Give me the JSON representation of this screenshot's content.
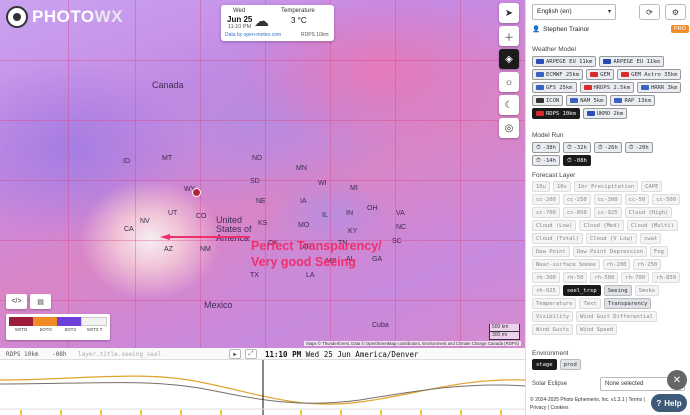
{
  "logo": {
    "text_a": "PHOTO",
    "text_b": "WX"
  },
  "weather": {
    "day": "Wed",
    "date": "Jun 25",
    "time": "11:10 PM",
    "temp_label": "Temperature",
    "temp_value": "3 °C",
    "source": "Data by open-meteo.com",
    "model": "RDPS 10km"
  },
  "map": {
    "labels": [
      "Canada",
      "MT",
      "ND",
      "MN",
      "ID",
      "SD",
      "WI",
      "MI",
      "WY",
      "NE",
      "IA",
      "IL",
      "IN",
      "OH",
      "NV",
      "UT",
      "CO",
      "KS",
      "MO",
      "KY",
      "CA",
      "AZ",
      "NM",
      "OK",
      "AR",
      "TN",
      "TX",
      "LA",
      "MS",
      "AL",
      "GA",
      "SC",
      "NC",
      "VA",
      "United States of America",
      "Mexico",
      "Cuba"
    ],
    "annotation_line1": "Perfect Transparency/",
    "annotation_line2": "Very good Seeing",
    "attribution": "Maps © Thunderforest, Data © OpenStreetMap contributors, Environment and Climate Change Canada (RDPS)",
    "scale_km": "500 km",
    "scale_mi": "300 mi"
  },
  "legend": {
    "labels": [
      "5OTO",
      "5OTO",
      "5OT3",
      "5OT3 T"
    ],
    "colors": [
      "#9b1d3a",
      "#f08a24",
      "#6c3fd8",
      "#f2f2f2"
    ]
  },
  "timeline": {
    "model": "RDPS 10km",
    "offset": "-08h",
    "layer": "layer.title.seeing_seal",
    "current_time": "11:10 PM",
    "current_date": "Wed 25 Jun America/Denver"
  },
  "panel": {
    "language": "English (en)",
    "user": "Stephen Trainor",
    "pro_badge": "PRO",
    "weather_model_title": "Weather Model",
    "models": [
      {
        "label": "ARPEGE EU 11km",
        "flag": "#2a4fbd",
        "sel": false
      },
      {
        "label": "ARPEGE EU 11km",
        "flag": "#234ba8",
        "sel": false
      },
      {
        "label": "ECMWF 25km",
        "flag": "#3a62c2",
        "sel": false
      },
      {
        "label": "GEM",
        "flag": "#d92b2b",
        "sel": false
      },
      {
        "label": "GEM Astro 35km",
        "flag": "#d92b2b",
        "sel": false
      },
      {
        "label": "GFS 25km",
        "flag": "#3a62c2",
        "sel": false
      },
      {
        "label": "HRDPS 2.5km",
        "flag": "#d92b2b",
        "sel": false
      },
      {
        "label": "HRRR 3km",
        "flag": "#3a62c2",
        "sel": false
      },
      {
        "label": "ICON",
        "flag": "#333333",
        "sel": false
      },
      {
        "label": "NAM 5km",
        "flag": "#3a62c2",
        "sel": false
      },
      {
        "label": "RAP 13km",
        "flag": "#3a62c2",
        "sel": false
      },
      {
        "label": "RDPS 10km",
        "flag": "#d92b2b",
        "sel": true
      },
      {
        "label": "UKMO 2km",
        "flag": "#2a4fbd",
        "sel": false
      }
    ],
    "model_run_title": "Model Run",
    "runs": [
      {
        "label": "-38h",
        "sel": false
      },
      {
        "label": "-32h",
        "sel": false
      },
      {
        "label": "-26h",
        "sel": false
      },
      {
        "label": "-20h",
        "sel": false
      },
      {
        "label": "-14h",
        "sel": false
      },
      {
        "label": "-08h",
        "sel": true
      }
    ],
    "forecast_layer_title": "Forecast Layer",
    "layers": [
      {
        "label": "10u",
        "state": "light"
      },
      {
        "label": "10v",
        "state": "light"
      },
      {
        "label": "1hr Precipitation",
        "state": "light"
      },
      {
        "label": "CAPE",
        "state": "light"
      },
      {
        "label": "cc-200",
        "state": "light"
      },
      {
        "label": "cc-250",
        "state": "light"
      },
      {
        "label": "cc-300",
        "state": "light"
      },
      {
        "label": "cc-50",
        "state": "light"
      },
      {
        "label": "cc-500",
        "state": "light"
      },
      {
        "label": "cc-700",
        "state": "light"
      },
      {
        "label": "cc-850",
        "state": "light"
      },
      {
        "label": "cc-925",
        "state": "light"
      },
      {
        "label": "Cloud (High)",
        "state": "light"
      },
      {
        "label": "Cloud (Low)",
        "state": "light"
      },
      {
        "label": "Cloud (Med)",
        "state": "light"
      },
      {
        "label": "Cloud (Multi)",
        "state": "light"
      },
      {
        "label": "Cloud (Total)",
        "state": "light"
      },
      {
        "label": "Cloud (V Low)",
        "state": "light"
      },
      {
        "label": "cwat",
        "state": "light"
      },
      {
        "label": "Dew Point",
        "state": "light"
      },
      {
        "label": "Dew Point Depression",
        "state": "light"
      },
      {
        "label": "Fog",
        "state": "light"
      },
      {
        "label": "Near-surface Smoke",
        "state": "light"
      },
      {
        "label": "rh-200",
        "state": "light"
      },
      {
        "label": "rh-250",
        "state": "light"
      },
      {
        "label": "rh-300",
        "state": "light"
      },
      {
        "label": "rh-50",
        "state": "light"
      },
      {
        "label": "rh-500",
        "state": "light"
      },
      {
        "label": "rh-700",
        "state": "light"
      },
      {
        "label": "rh-850",
        "state": "light"
      },
      {
        "label": "rh-925",
        "state": "light"
      },
      {
        "label": "seel_trsp",
        "state": "sel"
      },
      {
        "label": "Seeing",
        "state": "mid"
      },
      {
        "label": "Smoke",
        "state": "light"
      },
      {
        "label": "Temperature",
        "state": "light"
      },
      {
        "label": "Text",
        "state": "light"
      },
      {
        "label": "Transparency",
        "state": "mid"
      },
      {
        "label": "Visibility",
        "state": "light"
      },
      {
        "label": "Wind Gust Differential",
        "state": "light"
      },
      {
        "label": "Wind Gusts",
        "state": "light"
      },
      {
        "label": "Wind Speed",
        "state": "light"
      }
    ],
    "environment_title": "Environment",
    "environments": [
      {
        "label": "stage",
        "sel": true
      },
      {
        "label": "prod",
        "sel": false
      }
    ],
    "solar_title": "Solar Eclipse",
    "solar_value": "None selected",
    "footer_line1": "© 2024-2025 Photo Ephemeris, Inc. v1.3.1 | Terms | Privacy | Cookies",
    "help": "Help"
  }
}
